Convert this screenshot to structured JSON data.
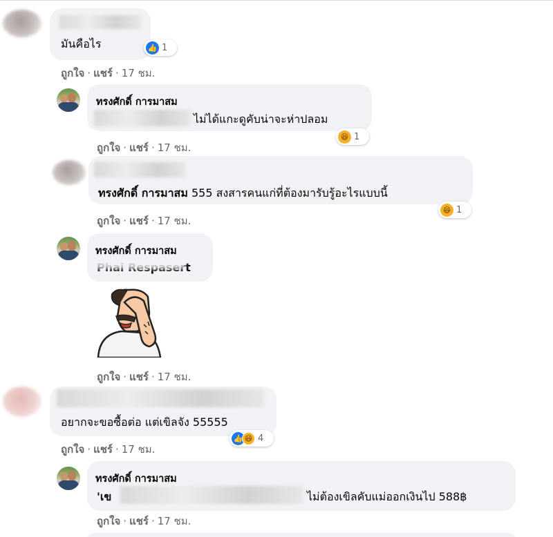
{
  "actions": {
    "like": "ถูกใจ",
    "share": "แชร์",
    "sep": "·"
  },
  "comments": [
    {
      "author": "",
      "text": "มันคือไร",
      "time": "17 ชม.",
      "reaction_count": "1",
      "reaction_icons": [
        "like-icon"
      ]
    },
    {
      "author": "ทรงศักดิ์ การมาสม",
      "text": "ไม่ได้แกะดูคับน่าจะห่าปลอม",
      "time": "17 ชม.",
      "reaction_count": "1",
      "reaction_icons": [
        "haha-icon"
      ]
    },
    {
      "author": "",
      "tag": "ทรงศักดิ์ การมาสม",
      "text": "555 สงสารคนแก่ที่ต้องมารับรู้อะไรแบบนี้",
      "time": "17 ชม.",
      "reaction_count": "1",
      "reaction_icons": [
        "haha-icon"
      ]
    },
    {
      "author": "ทรงศักดิ์ การมาสม",
      "text": "Phai Respasert",
      "time": "17 ชม.",
      "sticker": "facepalm-sticker"
    },
    {
      "author": "",
      "text": "อยากจะขอซื้อต่อ แต่เขิลจัง 55555",
      "time": "17 ชม.",
      "reaction_count": "4",
      "reaction_icons": [
        "like-icon",
        "haha-icon"
      ]
    },
    {
      "author": "ทรงศักดิ์ การมาสม",
      "text": "ไม่ต้องเขิลคับแม่ออกเงินไป 588฿",
      "prefix": "'เข",
      "time": "17 ชม."
    }
  ],
  "colors": {
    "bubble": "#f0f2f5",
    "meta": "#65676b",
    "like": "#1877f2",
    "haha": "#f7b125"
  }
}
